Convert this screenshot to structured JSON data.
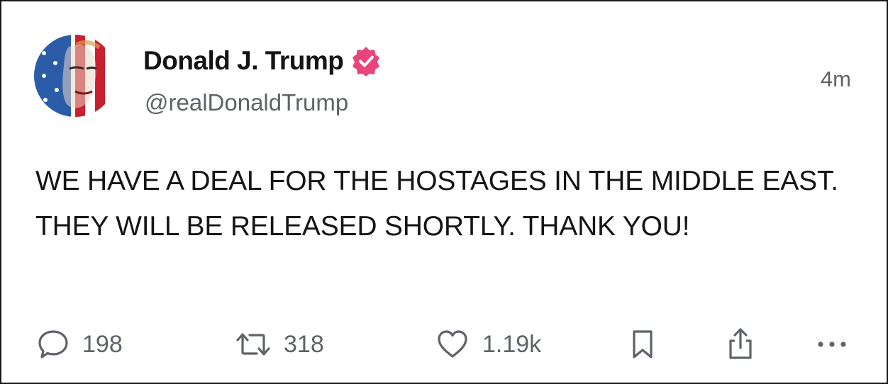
{
  "post": {
    "author": {
      "display_name": "Donald J. Trump",
      "handle": "@realDonaldTrump",
      "verified": true,
      "avatar_icon": "flag-portrait-avatar"
    },
    "timestamp": "4m",
    "text": "WE HAVE A DEAL FOR THE HOSTAGES IN THE MIDDLE EAST. THEY WILL BE RELEASED SHORTLY. THANK YOU!",
    "actions": {
      "reply": {
        "icon": "reply-bubble-icon",
        "count": "198"
      },
      "retruth": {
        "icon": "repost-arrows-icon",
        "count": "318"
      },
      "like": {
        "icon": "heart-icon",
        "count": "1.19k"
      },
      "bookmark": {
        "icon": "bookmark-icon"
      },
      "share": {
        "icon": "share-icon"
      },
      "more": {
        "icon": "more-dots-icon"
      }
    }
  },
  "colors": {
    "verified_badge": "#e8457a",
    "text_primary": "#141414",
    "text_secondary": "#5f6368",
    "flag_red": "#c8202f",
    "flag_blue": "#2a5ca8"
  }
}
